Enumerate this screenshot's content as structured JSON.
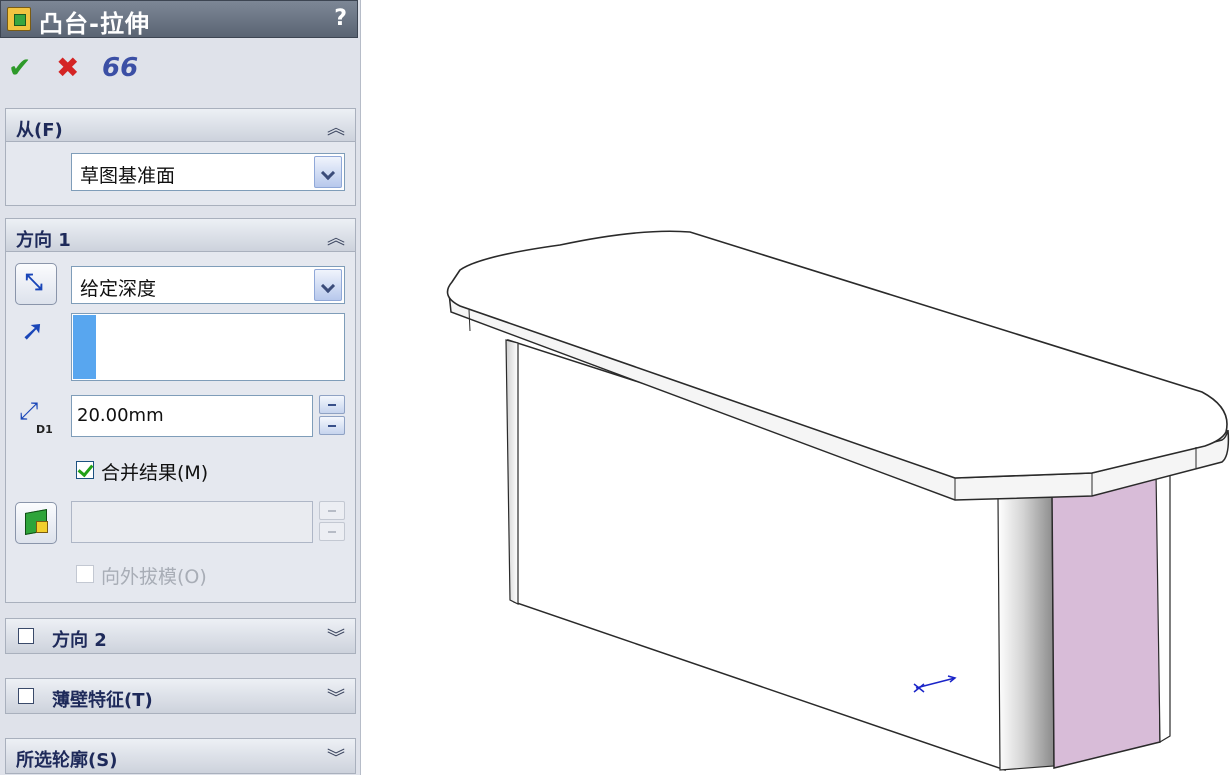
{
  "panel": {
    "title": "凸台-拉伸",
    "help": "?",
    "actions": {
      "ok": "✔",
      "cancel": "✖",
      "preview": "66"
    },
    "from": {
      "title": "从(F)",
      "value": "草图基准面"
    },
    "direction1": {
      "title": "方向 1",
      "end_condition": "给定深度",
      "depth": "20.00mm",
      "merge_label": "合并结果(M)",
      "merge_checked": true,
      "draft_label": "向外拔模(O)",
      "draft_checked": false
    },
    "direction2": {
      "title": "方向 2",
      "checked": false
    },
    "thin_feature": {
      "title": "薄壁特征(T)",
      "checked": false
    },
    "selected_contours": {
      "title": "所选轮廓(S)"
    }
  },
  "colors": {
    "panel_bg": "#dfe2ea",
    "title_bg": "#5a6473",
    "body_face": "#ffffff",
    "end_face": "#d8bcd8",
    "edge": "#2a2a2a",
    "triad": "#1a24c8"
  }
}
